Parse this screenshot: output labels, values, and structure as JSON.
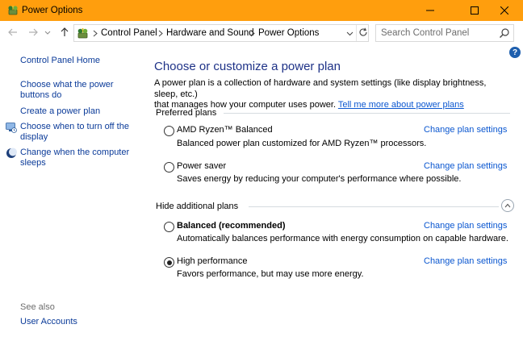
{
  "window": {
    "title": "Power Options",
    "controls": {
      "minimize": "minimize-icon",
      "maximize": "maximize-icon",
      "close": "close-icon"
    }
  },
  "nav": {
    "breadcrumbs": [
      "Control Panel",
      "Hardware and Sound",
      "Power Options"
    ],
    "search_placeholder": "Search Control Panel"
  },
  "help_label": "?",
  "sidebar": {
    "home": "Control Panel Home",
    "items": [
      {
        "line1": "Choose what the power",
        "line2": "buttons do",
        "icon": null
      },
      {
        "line1": "Create a power plan",
        "line2": "",
        "icon": null
      },
      {
        "line1": "Choose when to turn off the",
        "line2": "display",
        "icon": "monitor-icon"
      },
      {
        "line1": "Change when the computer",
        "line2": "sleeps",
        "icon": "moon-sleep-icon"
      }
    ],
    "see_also": "See also",
    "see_also_links": [
      "User Accounts"
    ]
  },
  "main": {
    "title": "Choose or customize a power plan",
    "intro_line1": "A power plan is a collection of hardware and system settings (like display brightness, sleep, etc.)",
    "intro_line2": "that manages how your computer uses power.",
    "intro_link": "Tell me more about power plans",
    "preferred_header": "Preferred plans",
    "additional_header": "Hide additional plans",
    "plans": [
      {
        "name": "AMD Ryzen™ Balanced",
        "description": "Balanced power plan customized for AMD Ryzen™ processors.",
        "selected": false,
        "bold": false,
        "link": "Change plan settings"
      },
      {
        "name": "Power saver",
        "description": "Saves energy by reducing your computer's performance where possible.",
        "selected": false,
        "bold": false,
        "link": "Change plan settings"
      },
      {
        "name": "Balanced (recommended)",
        "description": "Automatically balances performance with energy consumption on capable hardware.",
        "selected": false,
        "bold": true,
        "link": "Change plan settings"
      },
      {
        "name": "High performance",
        "description": "Favors performance, but may use more energy.",
        "selected": true,
        "bold": false,
        "link": "Change plan settings"
      }
    ]
  },
  "colors": {
    "titlebar": "#ff9e0d",
    "heading": "#1e3287",
    "link": "#0b57d0",
    "help": "#1e5fae"
  }
}
